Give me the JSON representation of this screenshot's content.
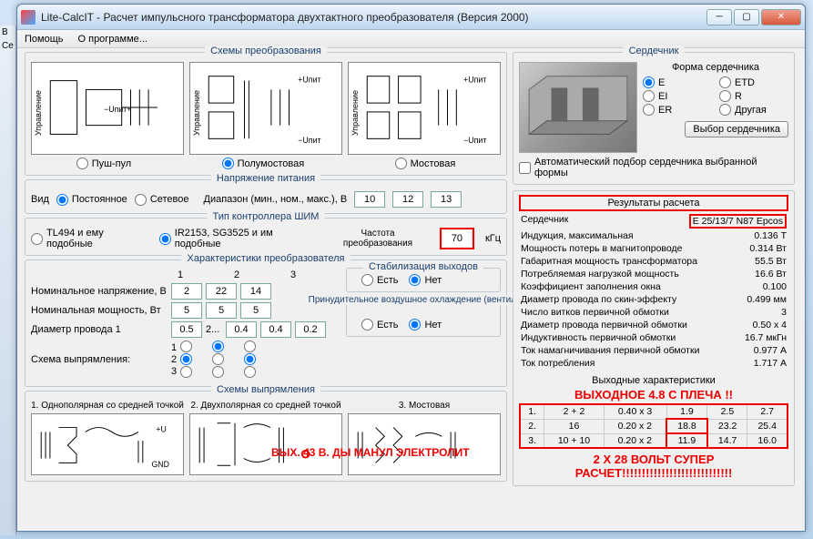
{
  "window": {
    "title": "Lite-CalcIT - Расчет импульсного трансформатора двухтактного преобразователя (Версия 2000)"
  },
  "menu": {
    "help": "Помощь",
    "about": "О программе..."
  },
  "side": {
    "l1": "В",
    "l2": "Се"
  },
  "schemes": {
    "title": "Схемы преобразования",
    "pushpull": "Пуш-пул",
    "halfbridge": "Полумостовая",
    "bridge": "Мостовая",
    "label_upit_plus": "+Uпит",
    "label_upit_minus": "−Uпит",
    "label_upit": "−Uпит+",
    "label_ctrl": "Управление"
  },
  "power": {
    "title": "Напряжение питания",
    "kind_label": "Вид",
    "kind_dc": "Постоянное",
    "kind_ac": "Сетевое",
    "range_label": "Диапазон (мин., ном., макс.), В",
    "min": "10",
    "nom": "12",
    "max": "13"
  },
  "controller": {
    "title": "Тип контроллера ШИМ",
    "opt1": "TL494 и ему подобные",
    "opt2": "IR2153, SG3525 и им подобные",
    "freq_label": "Частота преобразования",
    "freq": "70",
    "freq_unit": "кГц"
  },
  "char": {
    "title": "Характеристики преобразователя",
    "nom_v_label": "Номинальное напряжение, В",
    "nom_p_label": "Номинальная мощность, Вт",
    "wire_label": "Диаметр провода",
    "col1": "1",
    "col2": "2",
    "col3": "3",
    "v1": "2",
    "v2": "22",
    "v3": "14",
    "p1": "5",
    "p2": "5",
    "p3": "5",
    "w0": "0.5",
    "wlbl2": "2...",
    "w1": "0.4",
    "w2": "0.4",
    "w3": "0.2",
    "rect_label": "Схема выпрямления:",
    "stab_title": "Стабилизация выходов",
    "yes": "Есть",
    "no": "Нет",
    "cool_title": "Принудительное воздушное охлаждение (вентилятор)"
  },
  "rect_schemes": {
    "title": "Схемы выпрямления",
    "s1": "1. Однополярная со средней точкой",
    "s2": "2. Двухполярная со средней точкой",
    "s3": "3. Мостовая",
    "plusU": "+U",
    "gnd": "GND"
  },
  "core": {
    "title": "Сердечник",
    "form_title": "Форма сердечника",
    "e": "E",
    "etd": "ETD",
    "ei": "EI",
    "r": "R",
    "er": "ER",
    "other": "Другая",
    "select_btn": "Выбор сердечника",
    "auto": "Автоматический подбор сердечника выбранной формы"
  },
  "results": {
    "title": "Результаты расчета",
    "core_label": "Сердечник",
    "core_val": "E 25/13/7 N87 Epcos",
    "rows": [
      {
        "l": "Индукция, максимальная",
        "v": "0.136 Т"
      },
      {
        "l": "Мощность потерь в магнитопроводе",
        "v": "0.314 Вт"
      },
      {
        "l": "Габаритная мощность трансформатора",
        "v": "55.5 Вт"
      },
      {
        "l": "Потребляемая нагрузкой мощность",
        "v": "16.6 Вт"
      },
      {
        "l": "Коэффициент заполнения окна",
        "v": "0.100"
      },
      {
        "l": "Диаметр провода по скин-эффекту",
        "v": "0.499 мм"
      },
      {
        "l": "Число витков первичной обмотки",
        "v": "3"
      },
      {
        "l": "Диаметр провода первичной обмотки",
        "v": "0.50 x 4"
      },
      {
        "l": "Индуктивность первичной обмотки",
        "v": "16.7 мкГн"
      },
      {
        "l": "Ток намагничивания первичной обмотки",
        "v": "0.977 А"
      },
      {
        "l": "Ток потребления",
        "v": "1.717 А"
      }
    ],
    "out_title": "Выходные характеристики",
    "out_rows": [
      [
        "1.",
        "2 + 2",
        "0.40 x 3",
        "1.9",
        "2.5",
        "2.7"
      ],
      [
        "2.",
        "16",
        "0.20 x 2",
        "18.8",
        "23.2",
        "25.4"
      ],
      [
        "3.",
        "10 + 10",
        "0.20 x 2",
        "11.9",
        "14.7",
        "16.0"
      ]
    ]
  },
  "anno": {
    "out48": "ВЫХОДНОЕ 4.8 С ПЛЕЧА !!",
    "out43": "ВЫХ. 43 В. ДЫ МАНУЛ ЭЛЕКТРОЛИТ",
    "bottom": "2 Х 28 ВОЛЬТ  СУПЕР РАСЧЕТ!!!!!!!!!!!!!!!!!!!!!!!!!!!!"
  }
}
